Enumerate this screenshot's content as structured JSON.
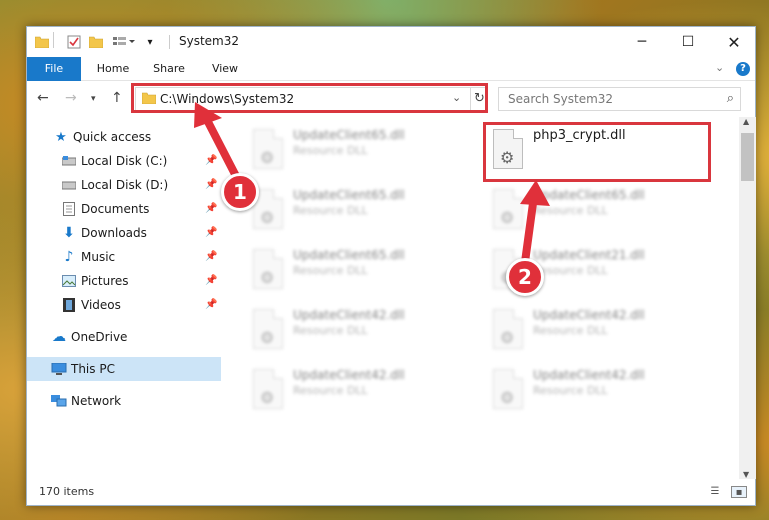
{
  "window": {
    "title": "System32"
  },
  "ribbon": {
    "tabs": [
      "File",
      "Home",
      "Share",
      "View"
    ]
  },
  "nav": {
    "address": "C:\\Windows\\System32",
    "search_placeholder": "Search System32"
  },
  "sidebar": {
    "items": [
      {
        "label": "Quick access",
        "icon": "star-icon"
      },
      {
        "label": "Local Disk (C:)",
        "icon": "drive-icon"
      },
      {
        "label": "Local Disk (D:)",
        "icon": "drive-icon"
      },
      {
        "label": "Documents",
        "icon": "documents-icon"
      },
      {
        "label": "Downloads",
        "icon": "download-icon"
      },
      {
        "label": "Music",
        "icon": "music-icon"
      },
      {
        "label": "Pictures",
        "icon": "pictures-icon"
      },
      {
        "label": "Videos",
        "icon": "videos-icon"
      },
      {
        "label": "OneDrive",
        "icon": "cloud-icon"
      },
      {
        "label": "This PC",
        "icon": "computer-icon"
      },
      {
        "label": "Network",
        "icon": "network-icon"
      }
    ]
  },
  "files": {
    "left": [
      {
        "name": "UpdateClient65.dll",
        "type": "Resource DLL"
      },
      {
        "name": "UpdateClient65.dll",
        "type": "Resource DLL"
      },
      {
        "name": "UpdateClient65.dll",
        "type": "Resource DLL"
      },
      {
        "name": "UpdateClient42.dll",
        "type": "Resource DLL"
      },
      {
        "name": "UpdateClient42.dll",
        "type": "Resource DLL"
      }
    ],
    "right": [
      {
        "name": "php3_crypt.dll",
        "type": ""
      },
      {
        "name": "UpdateClient65.dll",
        "type": "Resource DLL"
      },
      {
        "name": "UpdateClient21.dll",
        "type": "Resource DLL"
      },
      {
        "name": "UpdateClient42.dll",
        "type": "Resource DLL"
      },
      {
        "name": "UpdateClient42.dll",
        "type": "Resource DLL"
      }
    ]
  },
  "status": {
    "items_count": "170 items"
  },
  "callouts": {
    "one": "1",
    "two": "2"
  },
  "colors": {
    "accent": "#1979ca",
    "highlight": "#d9363e"
  }
}
